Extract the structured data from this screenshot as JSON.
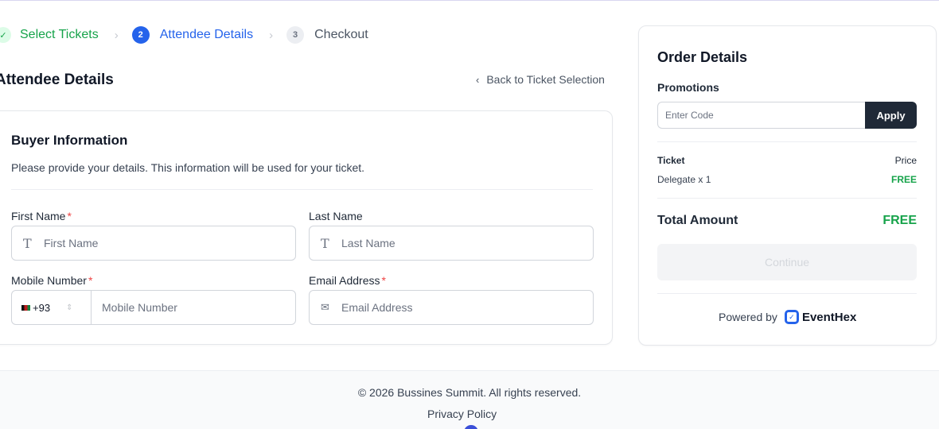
{
  "stepper": {
    "steps": [
      {
        "number": "✓",
        "label": "Select Tickets",
        "state": "done"
      },
      {
        "number": "2",
        "label": "Attendee Details",
        "state": "active"
      },
      {
        "number": "3",
        "label": "Checkout",
        "state": "idle"
      }
    ],
    "separator": "›"
  },
  "page": {
    "title": "Attendee Details",
    "back_link": "Back to Ticket Selection"
  },
  "buyer": {
    "title": "Buyer Information",
    "description": "Please provide your details. This information will be used for your ticket.",
    "first_name": {
      "label": "First Name",
      "required": "*",
      "placeholder": "First Name",
      "value": ""
    },
    "last_name": {
      "label": "Last Name",
      "placeholder": "Last Name",
      "value": ""
    },
    "mobile": {
      "label": "Mobile Number",
      "required": "*",
      "dial_code": "+93",
      "placeholder": "Mobile Number",
      "value": ""
    },
    "email": {
      "label": "Email Address",
      "required": "*",
      "placeholder": "Email Address",
      "value": ""
    }
  },
  "order": {
    "title": "Order Details",
    "promotions_label": "Promotions",
    "promo_placeholder": "Enter Code",
    "apply_label": "Apply",
    "ticket_header": "Ticket",
    "price_header": "Price",
    "items": [
      {
        "name": "Delegate x 1",
        "price": "FREE"
      }
    ],
    "total_label": "Total Amount",
    "total_value": "FREE",
    "continue_label": "Continue",
    "powered_by": "Powered by",
    "brand": "EventHex"
  },
  "footer": {
    "copyright": "© 2026 Bussines Summit. All rights reserved.",
    "privacy": "Privacy Policy"
  },
  "colors": {
    "primary": "#2563eb",
    "success": "#16a34a",
    "required": "#ef4444",
    "dark_button": "#1f2937"
  },
  "icons": {
    "completed_step": "check-icon",
    "back": "chevron-left-icon",
    "text_field": "text-icon",
    "email_field": "mail-icon",
    "dial_select": "updown-icon"
  }
}
